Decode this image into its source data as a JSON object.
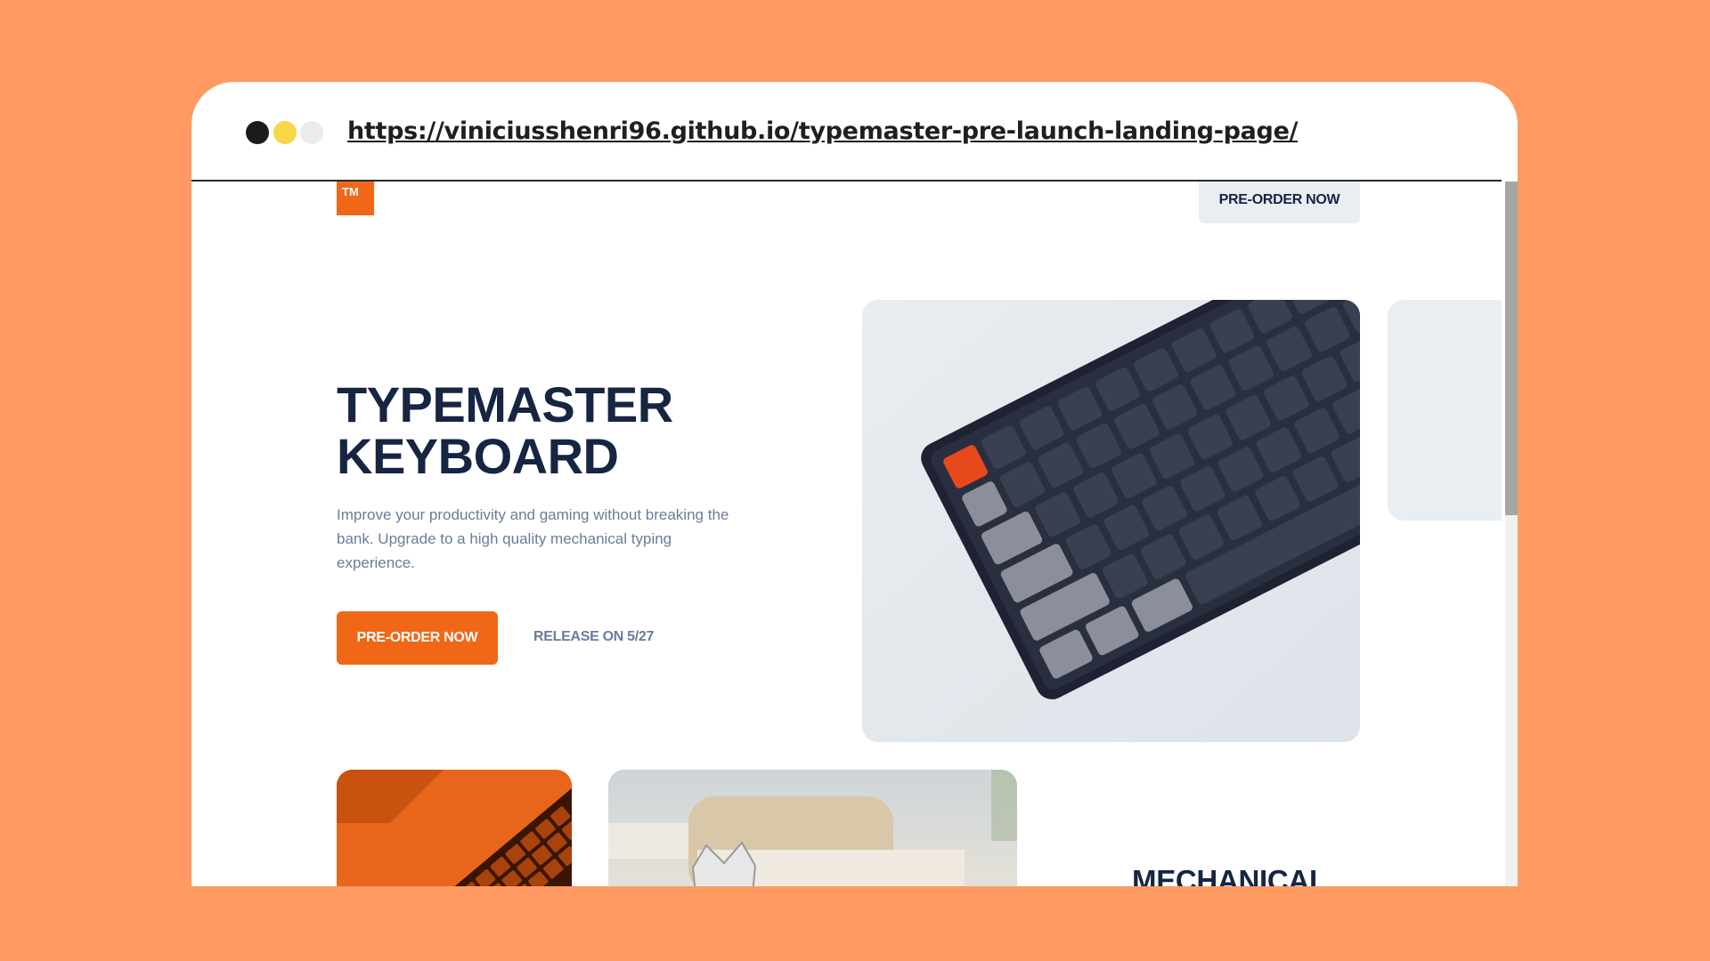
{
  "browser": {
    "url": "https://viniciusshenri96.github.io/typemaster-pre-launch-landing-page/"
  },
  "nav": {
    "logo_text": "TM",
    "preorder_label": "PRE-ORDER NOW"
  },
  "hero": {
    "title_line1": "TYPEMASTER",
    "title_line2": "KEYBOARD",
    "description": "Improve your productivity and gaming without breaking the bank. Upgrade to a high quality mechanical typing experience.",
    "cta_label": "PRE-ORDER NOW",
    "release_label": "RELEASE ON 5/27"
  },
  "features": {
    "heading": "MECHANICAL"
  },
  "colors": {
    "page_bg": "#ff9a62",
    "accent": "#f16718",
    "heading": "#152542",
    "muted": "#6b7c99",
    "secondary_button_bg": "#e9eef2"
  }
}
